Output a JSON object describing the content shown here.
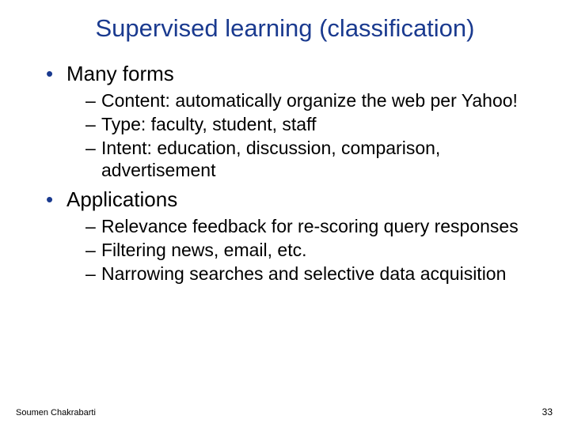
{
  "title": "Supervised learning (classification)",
  "bullets": {
    "b1": "Many forms",
    "b1_1": "Content: automatically organize the web per Yahoo!",
    "b1_2": "Type: faculty, student, staff",
    "b1_3": "Intent: education, discussion, comparison, advertisement",
    "b2": "Applications",
    "b2_1": "Relevance feedback for re-scoring query responses",
    "b2_2": "Filtering news, email, etc.",
    "b2_3": "Narrowing searches and selective data acquisition"
  },
  "footer": {
    "author": "Soumen Chakrabarti",
    "page": "33"
  }
}
